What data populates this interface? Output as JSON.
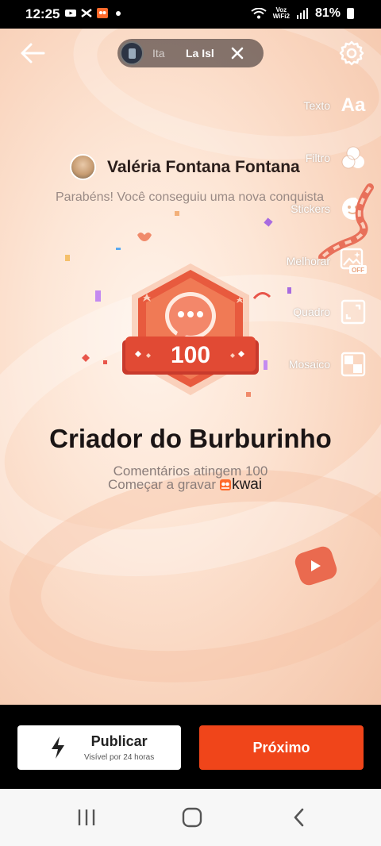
{
  "status_bar": {
    "time": "12:25",
    "network_label": "Voz\nWiFi2",
    "battery": "81%"
  },
  "music": {
    "title_part1": "Ita",
    "title_part2": "La Isl"
  },
  "tools": [
    {
      "label": "Texto",
      "icon": "text-aa-icon"
    },
    {
      "label": "Filtro",
      "icon": "filter-circles-icon"
    },
    {
      "label": "Stickers",
      "icon": "sticker-icon"
    },
    {
      "label": "Melhorar",
      "icon": "enhance-off-icon",
      "badge": "OFF"
    },
    {
      "label": "Quadro",
      "icon": "frame-icon"
    },
    {
      "label": "Mosaico",
      "icon": "mosaic-icon"
    }
  ],
  "text_icon_label": "Aa",
  "achievement": {
    "user_name": "Valéria Fontana Fontana",
    "congrats": "Parabéns! Você conseguiu uma nova conquista",
    "badge_number": "100",
    "title": "Criador do Burburinho",
    "subtitle": "Comentários atingem 100",
    "cta": "Começar a gravar",
    "brand": "kwai"
  },
  "actions": {
    "publish_label": "Publicar",
    "publish_sub": "Visível por 24 horas",
    "next_label": "Próximo"
  },
  "colors": {
    "accent": "#f0451a",
    "badge_red": "#e14a34"
  }
}
